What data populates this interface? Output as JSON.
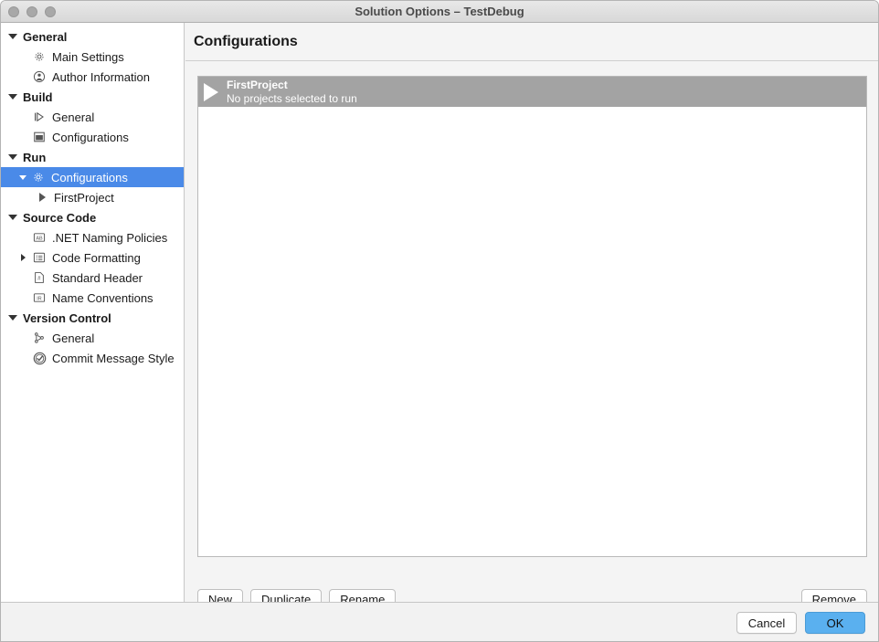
{
  "window": {
    "title": "Solution Options – TestDebug",
    "traffic_lights": [
      "close-button",
      "minimize-button",
      "zoom-button"
    ],
    "accent_color": "#4a8ae8",
    "primary_button_color": "#5ab0ef",
    "project_row_color": "#a3a3a3"
  },
  "sidebar": {
    "items": [
      {
        "label": "General",
        "level": "group",
        "icon": "disclosure-down-icon",
        "expanded": true,
        "selected": false
      },
      {
        "label": "Main Settings",
        "level": "child",
        "icon": "gear-icon",
        "selected": false
      },
      {
        "label": "Author Information",
        "level": "child",
        "icon": "person-icon",
        "selected": false
      },
      {
        "label": "Build",
        "level": "group",
        "icon": "disclosure-down-icon",
        "expanded": true,
        "selected": false
      },
      {
        "label": "General",
        "level": "child",
        "icon": "build-arrow-icon",
        "selected": false
      },
      {
        "label": "Configurations",
        "level": "child",
        "icon": "window-icon",
        "selected": false
      },
      {
        "label": "Run",
        "level": "group",
        "icon": "disclosure-down-icon",
        "expanded": true,
        "selected": false
      },
      {
        "label": "Configurations",
        "level": "child",
        "icon": "gear-icon",
        "selected": true,
        "expanded": true
      },
      {
        "label": "FirstProject",
        "level": "grandchild",
        "icon": "play-arrow-icon",
        "selected": false
      },
      {
        "label": "Source Code",
        "level": "group",
        "icon": "disclosure-down-icon",
        "expanded": true,
        "selected": false
      },
      {
        "label": ".NET Naming Policies",
        "level": "child",
        "icon": "ab-box-icon",
        "selected": false
      },
      {
        "label": "Code Formatting",
        "level": "child",
        "icon": "list-box-icon",
        "selected": false,
        "expandable": true
      },
      {
        "label": "Standard Header",
        "level": "child",
        "icon": "hash-document-icon",
        "selected": false
      },
      {
        "label": "Name Conventions",
        "level": "child",
        "icon": "ir-box-icon",
        "selected": false
      },
      {
        "label": "Version Control",
        "level": "group",
        "icon": "disclosure-down-icon",
        "expanded": true,
        "selected": false
      },
      {
        "label": "General",
        "level": "child",
        "icon": "branch-icon",
        "selected": false
      },
      {
        "label": "Commit Message Style",
        "level": "child",
        "icon": "check-circle-icon",
        "selected": false
      }
    ]
  },
  "main": {
    "header_title": "Configurations",
    "list": {
      "rows": [
        {
          "name": "FirstProject",
          "subtitle": "No projects selected to run",
          "icon": "play-arrow-icon",
          "selected": true
        }
      ]
    },
    "toolbar": {
      "new_label": "New",
      "duplicate_label": "Duplicate",
      "rename_label": "Rename",
      "remove_label": "Remove"
    }
  },
  "footer": {
    "cancel_label": "Cancel",
    "ok_label": "OK"
  }
}
